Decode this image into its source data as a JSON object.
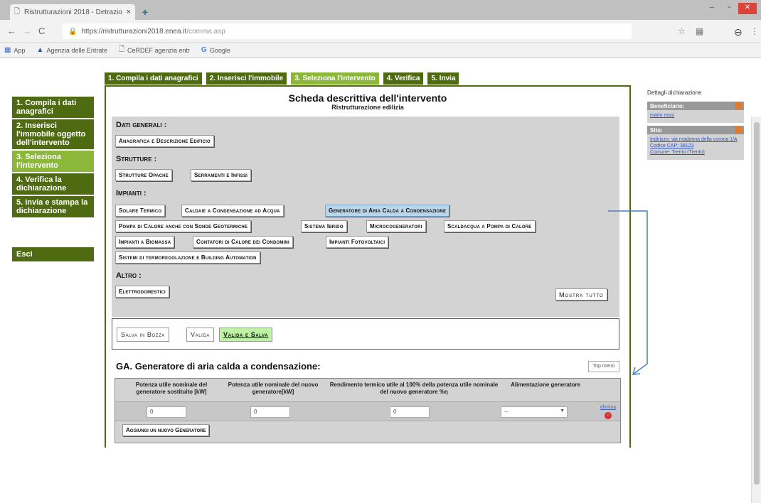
{
  "browser": {
    "tab_title": "Ristrutturazioni 2018 - Detrazio",
    "tab_close": "×",
    "new_tab": "+",
    "url_host": "https://ristrutturazioni2018.enea.it",
    "url_path": "/comma.asp",
    "bookmarks": [
      {
        "icon": "apps-icon",
        "label": "App"
      },
      {
        "icon": "agenzia-icon",
        "label": "Agenzia delle Entrate"
      },
      {
        "icon": "doc-icon",
        "label": "CeRDEF agenzia entr"
      },
      {
        "icon": "google-icon",
        "label": "Google"
      }
    ]
  },
  "left_nav": {
    "items": [
      {
        "label": "1. Compila i dati anagrafici",
        "active": false
      },
      {
        "label": "2. Inserisci l'immobile oggetto dell'intervento",
        "active": false
      },
      {
        "label": "3. Seleziona l'intervento",
        "active": true
      },
      {
        "label": "4. Verifica la dichiarazione",
        "active": false
      },
      {
        "label": "5. Invia e stampa la dichiarazione",
        "active": false
      }
    ],
    "exit": "Esci"
  },
  "steps": [
    {
      "label": "1. Compila i dati anagrafici",
      "active": false
    },
    {
      "label": "2. Inserisci l'immobile",
      "active": false
    },
    {
      "label": "3. Seleziona l'intervento",
      "active": true
    },
    {
      "label": "4. Verifica",
      "active": false
    },
    {
      "label": "5. Invia",
      "active": false
    }
  ],
  "scheda": {
    "title": "Scheda descrittiva dell'intervento",
    "subtitle": "Ristrutturazione edilizia"
  },
  "sections": {
    "dati_generali": "Dati generali :",
    "strutture": "Strutture :",
    "impianti": "Impianti :",
    "altro": "Altro :"
  },
  "buttons": {
    "anagrafica": "Anagrafica e Descrizione Edificio",
    "strutture_opache": "Strutture Opache",
    "serramenti": "Serramenti e Infissi",
    "solare": "Solare Termico",
    "caldaie": "Caldaie a Condensazione ad Acqua",
    "generatore_aria": "Generatore di Aria Calda a Condensazione",
    "pompa": "Pompa di Calore anche con Sonde Geotermiche",
    "ibrido": "Sistema Ibrido",
    "micro": "Microcogeneratori",
    "scaldacqua": "Scaldacqua a Pompa di Calore",
    "biomassa": "Impianti a Biomassa",
    "contatori": "Contatori di Calore dei Condomini",
    "fotovoltaici": "Impianti Fotovoltaici",
    "termoregolazione": "Sistemi di termoregolazione e Building Automation",
    "elettrodomestici": "Elettrodomestici",
    "mostra_tutto": "Mostra tutto"
  },
  "actions": {
    "bozza": "Salva in Bozza",
    "valida": "Valida",
    "valida_salva": "Valida e Salva"
  },
  "ga": {
    "title": "GA. Generatore di aria calda a condensazione:",
    "top_menu": "Top menù",
    "headers": [
      "Potenza utile nominale del generatore sostituito [kW]",
      "Potenza utile nominale del nuovo generatore[kW]",
      "Rendimento termico utile al 100% della potenza utile nominale del nuovo generatore %η",
      "Alimentazione generatore"
    ],
    "values": [
      "0",
      "0",
      "0"
    ],
    "select_value": "--",
    "remove_link": "elimina",
    "add_button": "Aggiungi un nuovo Generatore"
  },
  "right_panel": {
    "title": "Dettagli dichiarazione",
    "beneficiario_label": "Beneficiario:",
    "beneficiario": "mario rossi",
    "sito_label": "Sito:",
    "indirizzo": "Indirizzo: via madonna della corona 1/A",
    "cap": "Codice CAP: 38123",
    "comune": "Comune: Trento (Trento)"
  },
  "colors": {
    "nav_dark": "#4f6b12",
    "nav_active": "#8cb83a",
    "selected_button": "#b9d6ea",
    "valida_salva_bg": "#bdf2a4",
    "arrow": "#4a7fc1"
  }
}
